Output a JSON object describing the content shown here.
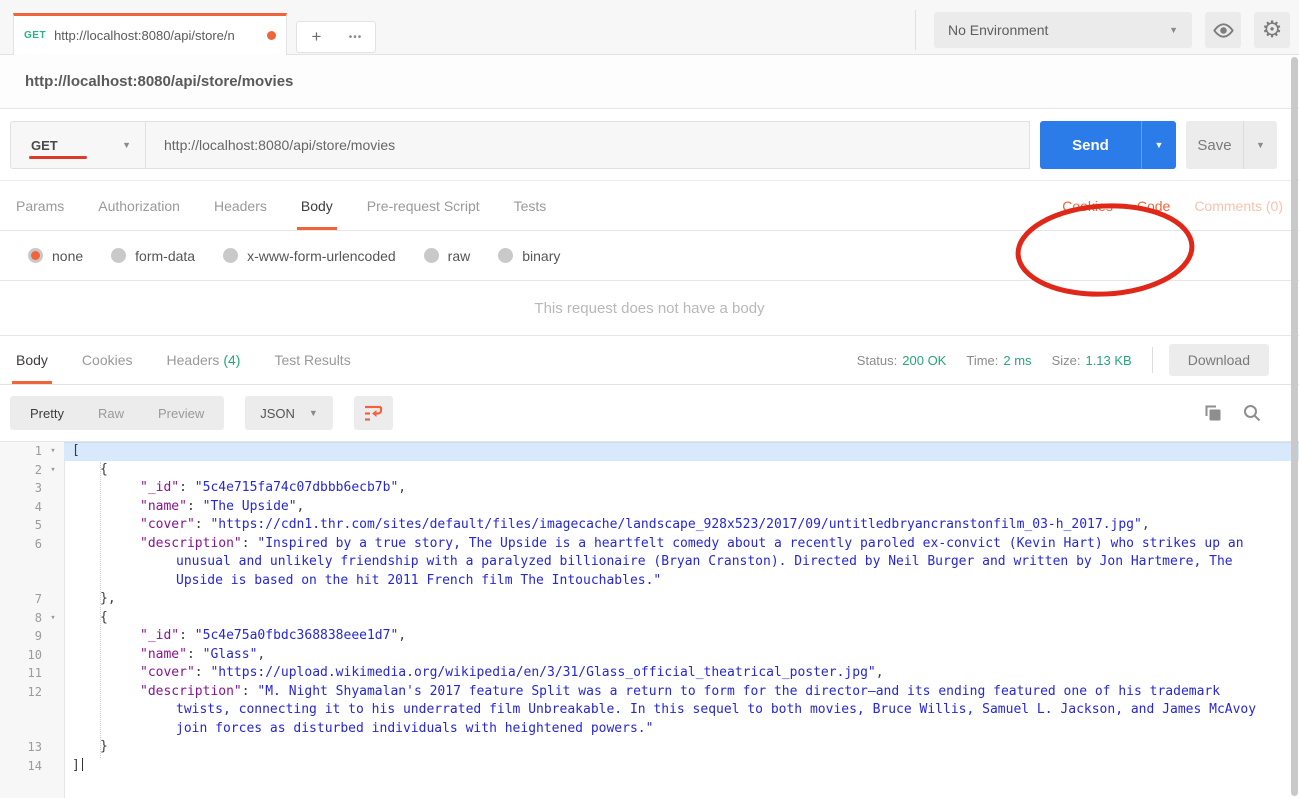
{
  "window": {
    "environment_selector": "No Environment",
    "tab": {
      "method": "GET",
      "url": "http://localhost:8080/api/store/n"
    },
    "new_tab_label": "+",
    "more_tabs_label": "•••"
  },
  "request": {
    "title_url": "http://localhost:8080/api/store/movies",
    "method": "GET",
    "url": "http://localhost:8080/api/store/movies",
    "send_label": "Send",
    "save_label": "Save",
    "tabs": [
      "Params",
      "Authorization",
      "Headers",
      "Body",
      "Pre-request Script",
      "Tests"
    ],
    "active_tab": "Body",
    "links": {
      "cookies": "Cookies",
      "code": "Code",
      "comments": "Comments (0)"
    },
    "body_types": [
      "none",
      "form-data",
      "x-www-form-urlencoded",
      "raw",
      "binary"
    ],
    "selected_body_type": "none",
    "empty_body_message": "This request does not have a body"
  },
  "response": {
    "tabs": {
      "body": "Body",
      "cookies": "Cookies",
      "headers": "Headers",
      "headers_count": "(4)",
      "test_results": "Test Results"
    },
    "active_tab": "Body",
    "status_label": "Status:",
    "status_value": "200 OK",
    "time_label": "Time:",
    "time_value": "2 ms",
    "size_label": "Size:",
    "size_value": "1.13 KB",
    "download_label": "Download",
    "view_modes": [
      "Pretty",
      "Raw",
      "Preview"
    ],
    "active_view": "Pretty",
    "format": "JSON",
    "code_lines": [
      {
        "n": "1",
        "fold": true,
        "indent": 0,
        "hl": true,
        "tokens": [
          [
            "p",
            "["
          ]
        ]
      },
      {
        "n": "2",
        "fold": true,
        "indent": 1,
        "tokens": [
          [
            "p",
            "{"
          ]
        ]
      },
      {
        "n": "3",
        "indent": 2,
        "tokens": [
          [
            "k",
            "\"_id\""
          ],
          [
            "p",
            ": "
          ],
          [
            "s",
            "\"5c4e715fa74c07dbbb6ecb7b\""
          ],
          [
            "p",
            ","
          ]
        ]
      },
      {
        "n": "4",
        "indent": 2,
        "tokens": [
          [
            "k",
            "\"name\""
          ],
          [
            "p",
            ": "
          ],
          [
            "s",
            "\"The Upside\""
          ],
          [
            "p",
            ","
          ]
        ]
      },
      {
        "n": "5",
        "indent": 2,
        "tokens": [
          [
            "k",
            "\"cover\""
          ],
          [
            "p",
            ": "
          ],
          [
            "s",
            "\"https://cdn1.thr.com/sites/default/files/imagecache/landscape_928x523/2017/09/untitledbryancranstonfilm_03-h_2017.jpg\""
          ],
          [
            "p",
            ","
          ]
        ]
      },
      {
        "n": "6",
        "indent": 2,
        "tokens": [
          [
            "k",
            "\"description\""
          ],
          [
            "p",
            ": "
          ],
          [
            "s",
            "\"Inspired by a true story, The Upside is a heartfelt comedy about a recently paroled ex-convict (Kevin Hart) who strikes up an unusual and unlikely friendship with a paralyzed billionaire (Bryan Cranston). Directed by Neil Burger and written by Jon Hartmere, The Upside is based on the hit 2011 French film The Intouchables.\""
          ]
        ]
      },
      {
        "n": "7",
        "indent": 1,
        "tokens": [
          [
            "p",
            "},"
          ]
        ]
      },
      {
        "n": "8",
        "fold": true,
        "indent": 1,
        "tokens": [
          [
            "p",
            "{"
          ]
        ]
      },
      {
        "n": "9",
        "indent": 2,
        "tokens": [
          [
            "k",
            "\"_id\""
          ],
          [
            "p",
            ": "
          ],
          [
            "s",
            "\"5c4e75a0fbdc368838eee1d7\""
          ],
          [
            "p",
            ","
          ]
        ]
      },
      {
        "n": "10",
        "indent": 2,
        "tokens": [
          [
            "k",
            "\"name\""
          ],
          [
            "p",
            ": "
          ],
          [
            "s",
            "\"Glass\""
          ],
          [
            "p",
            ","
          ]
        ]
      },
      {
        "n": "11",
        "indent": 2,
        "tokens": [
          [
            "k",
            "\"cover\""
          ],
          [
            "p",
            ": "
          ],
          [
            "s",
            "\"https://upload.wikimedia.org/wikipedia/en/3/31/Glass_official_theatrical_poster.jpg\""
          ],
          [
            "p",
            ","
          ]
        ]
      },
      {
        "n": "12",
        "indent": 2,
        "tokens": [
          [
            "k",
            "\"description\""
          ],
          [
            "p",
            ": "
          ],
          [
            "s",
            "\"M. Night Shyamalan's 2017 feature Split was a return to form for the director—and its ending featured one of his trademark twists, connecting it to his underrated film Unbreakable. In this sequel to both movies, Bruce Willis, Samuel L. Jackson, and James McAvoy join forces as disturbed individuals with heightened powers.\""
          ]
        ]
      },
      {
        "n": "13",
        "indent": 1,
        "tokens": [
          [
            "p",
            "}"
          ]
        ]
      },
      {
        "n": "14",
        "indent": 0,
        "cursor": true,
        "tokens": [
          [
            "p",
            "]"
          ]
        ]
      }
    ]
  },
  "colors": {
    "accent_orange": "#f0643c",
    "send_blue": "#2b7ce9",
    "success_green": "#26a779",
    "annotation_red": "#e02718",
    "json_key": "#881391",
    "json_string": "#2727d4"
  }
}
